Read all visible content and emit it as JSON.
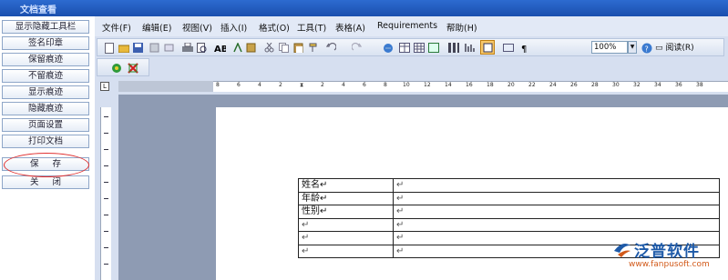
{
  "window": {
    "title": "文档查看"
  },
  "sidebar": {
    "buttons": [
      "显示隐藏工具栏",
      "签名印章",
      "保留痕迹",
      "不留痕迹",
      "显示痕迹",
      "隐藏痕迹",
      "页面设置",
      "打印文档",
      "保 存",
      "关 闭"
    ],
    "highlighted_button": "保 存",
    "highlight_color": "#e03030"
  },
  "menu": [
    "文件(F)",
    "编辑(E)",
    "视图(V)",
    "插入(I)",
    "格式(O)",
    "工具(T)",
    "表格(A)",
    "Requirements",
    "帮助(H)"
  ],
  "toolbar": {
    "zoom": "100%",
    "read_label": "阅读(R)",
    "icons": [
      "new-icon",
      "open-icon",
      "save-icon",
      "permission-icon",
      "email-icon",
      "print-icon",
      "print-preview-icon",
      "research-icon",
      "spelling-icon",
      "cut-icon",
      "copy-icon",
      "paste-icon",
      "format-painter-icon",
      "undo-icon",
      "redo-icon",
      "hyperlink-icon",
      "tables-icon",
      "insert-table-icon",
      "excel-icon",
      "columns-icon",
      "drawing-icon",
      "document-map-icon",
      "show-hide-icon",
      "help-icon"
    ],
    "toolbar2_icons": [
      "record-icon",
      "stop-icon"
    ]
  },
  "ruler": {
    "labels": [
      "8",
      "6",
      "4",
      "2",
      "2",
      "4",
      "6",
      "8",
      "10",
      "12",
      "14",
      "16",
      "18",
      "20",
      "22",
      "24",
      "26",
      "28",
      "30",
      "32",
      "34",
      "36",
      "38"
    ]
  },
  "document": {
    "table_rows": [
      [
        "姓名↵",
        "↵"
      ],
      [
        "年龄↵",
        "↵"
      ],
      [
        "性别↵",
        "↵"
      ],
      [
        "↵",
        "↵"
      ],
      [
        "↵",
        "↵"
      ],
      [
        "↵",
        "↵"
      ]
    ]
  },
  "watermark": {
    "brand": "泛普软件",
    "url": "www.fanpusoft.com"
  },
  "colors": {
    "accent": "#1e5aa8",
    "titlebar": "#1a4fae",
    "workspace": "#8e9bb3"
  }
}
